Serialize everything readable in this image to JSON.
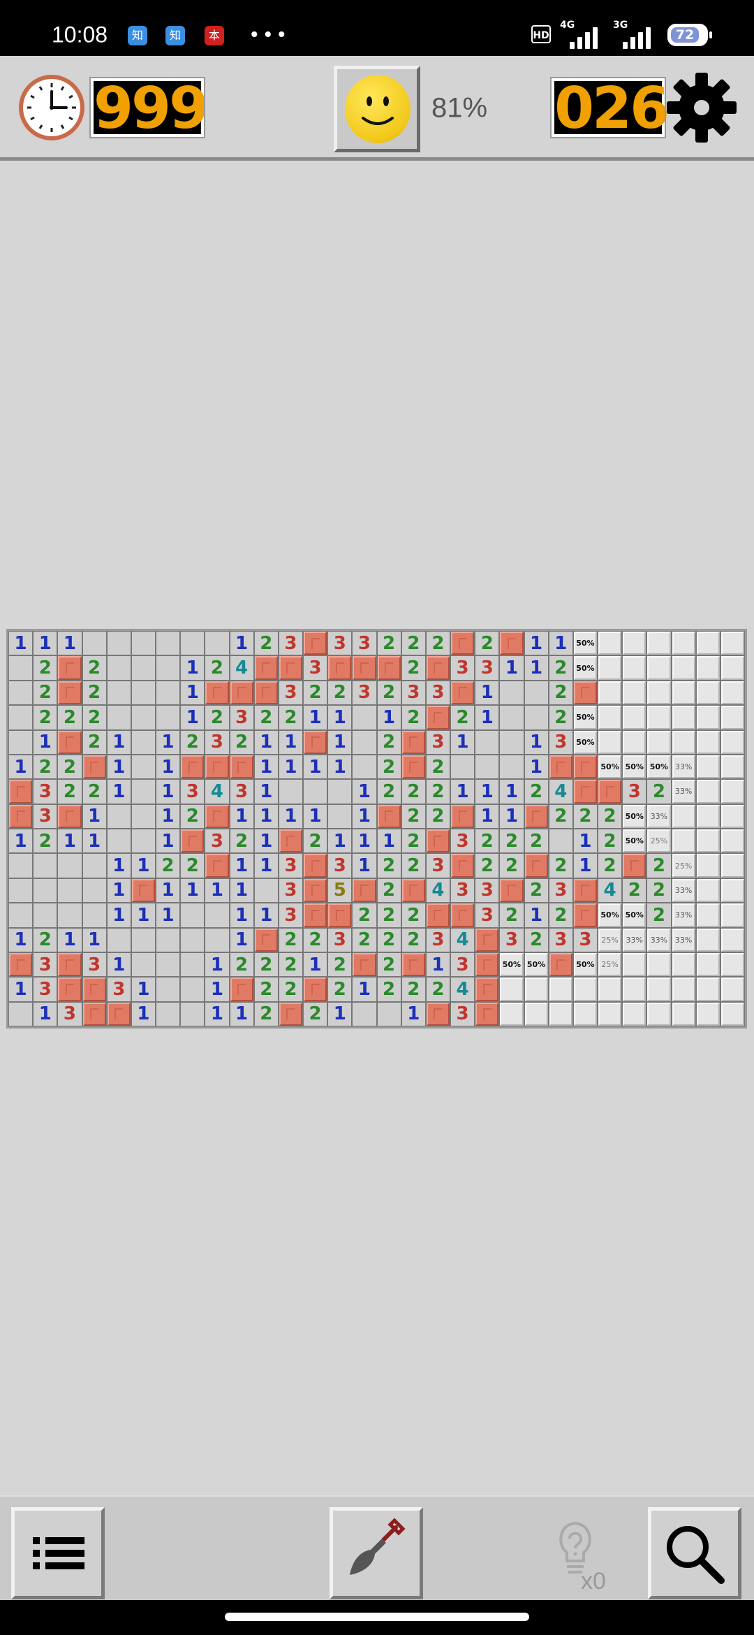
{
  "status_bar": {
    "time": "10:08",
    "app_icons": [
      {
        "label": "知",
        "color": "#3a8fe0"
      },
      {
        "label": "知",
        "color": "#3a8fe0"
      },
      {
        "label": "本",
        "color": "#d02020"
      }
    ],
    "more": "•••",
    "hd": "HD",
    "net1": "4G",
    "net2": "3G",
    "battery": "72"
  },
  "header": {
    "timer_icon": "clock-icon",
    "timer": "999",
    "smiley_icon": "smiley-face-icon",
    "percent": "81%",
    "mines_left": "026",
    "settings_icon": "gear-icon"
  },
  "board": {
    "cols": 30,
    "rows": [
      ".1 1 1 . . . . . . 1 2 3 F 3 3 2 2 2 F 2 F 1 1 ?50 ? ? ? ? ? ?",
      ". 2 F 2 . . . 1 2 4 F F 3 F F F 2 F 3 3 1 1 2 ?50 ? ? ? ? ? ?",
      ". 2 F 2 . . . 1 F F F 3 2 2 3 2 3 3 F 1 . . 2 F ? ? ? ? ? ?",
      ". 2 2 2 . . . 1 2 3 2 2 1 1 . 1 2 F 2 1 . . 2 ?50 ? ? ? ? ? ?",
      ". 1 F 2 1 . 1 2 3 2 1 1 F 1 . 2 F 3 1 . . 1 3 ?50 ? ? ? ? ? ?",
      "1 2 2 F 1 . 1 F F F 1 1 1 1 . 2 F 2 . . . 1 F F ?50 ?50 ?50 ?33 ? ?",
      "F 3 2 2 1 . 1 3 4 3 1 . . . 1 2 2 2 1 1 1 2 4 F F 3 2 ?33 ? ?",
      "F 3 F 1 . . 1 2 F 1 1 1 1 . 1 F 2 2 F 1 1 F 2 2 2 ?50 ?33 ? ? ?",
      "1 2 1 1 . . 1 F 3 2 1 F 2 1 1 1 2 F 3 2 2 2 . 1 2 ?50 ?25 ? ? ?",
      ". . . . 1 1 2 2 F 1 1 3 F 3 1 2 2 3 F 2 2 F 2 1 2 F 2 ?25 ? ?",
      ". . . . 1 F 1 1 1 1 . 3 F 5 F 2 F 4 3 3 F 2 3 F 4 2 2 ?33 ? ?",
      ". . . . 1 1 1 . . 1 1 3 F F 2 2 2 F F 3 2 1 2 F ?50 ?50 2 ?33 ? ?",
      "1 2 1 1 . . . . . 1 F 2 2 3 2 2 2 3 4 F 3 2 3 3 ?25 ?33 ?33 ?33 ? ?",
      "F 3 F 3 1 . . . 1 2 2 2 1 2 F 2 F 1 3 F ?50 ?50 F ?50 ?25 ? ? ? ? ?",
      "1 3 F F 3 1 . . 1 F 2 2 F 2 1 2 2 2 4 F ? ? ? ? ? ? ? ? ? ?",
      ". 1 3 F F 1 . . 1 1 2 F 2 1 . . 1 F 3 F ? ? ? ? ? ? ? ? ? ?"
    ]
  },
  "bottom_bar": {
    "menu_icon": "menu-list-icon",
    "dig_icon": "shovel-icon",
    "hint_icon": "lightbulb-question-icon",
    "hint_count": "x0",
    "zoom_icon": "magnifier-icon"
  },
  "colors": {
    "counter_digits": "#f0a000",
    "flag_cell": "#e07a64",
    "number_1": "#1c2fb8",
    "number_2": "#2a8a2a",
    "number_3": "#c0362c",
    "number_4": "#168a94",
    "number_5": "#8a7a10"
  }
}
